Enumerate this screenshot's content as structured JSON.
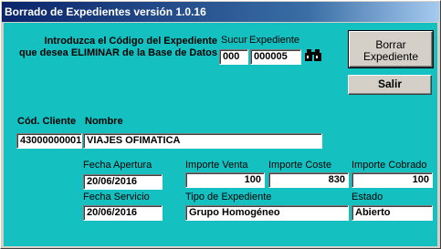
{
  "window": {
    "title": "Borrado de Expedientes  versión 1.0.16"
  },
  "prompt": {
    "line1": "Introduzca el Código del Expediente",
    "line2": "que desea ELIMINAR de la Base de Datos"
  },
  "search": {
    "sucur_label": "Sucur",
    "expediente_label": "Expediente",
    "sucur_value": "000",
    "expediente_value": "000005",
    "icon": "binoculars-icon"
  },
  "buttons": {
    "borrar_line1": "Borrar",
    "borrar_line2": "Expediente",
    "salir": "Salir"
  },
  "cliente": {
    "cod_label": "Cód. Cliente",
    "nombre_label": "Nombre",
    "cod_value": "43000000001",
    "nombre_value": "VIAJES OFIMATICA"
  },
  "detalle": {
    "fecha_apertura_label": "Fecha Apertura",
    "fecha_apertura_value": "20/06/2016",
    "importe_venta_label": "Importe Venta",
    "importe_venta_value": "100",
    "importe_coste_label": "Importe Coste",
    "importe_coste_value": "830",
    "importe_cobrado_label": "Importe Cobrado",
    "importe_cobrado_value": "100",
    "fecha_servicio_label": "Fecha Servicio",
    "fecha_servicio_value": "20/06/2016",
    "tipo_label": "Tipo de Expediente",
    "tipo_value": "Grupo Homogéneo",
    "estado_label": "Estado",
    "estado_value": "Abierto"
  }
}
